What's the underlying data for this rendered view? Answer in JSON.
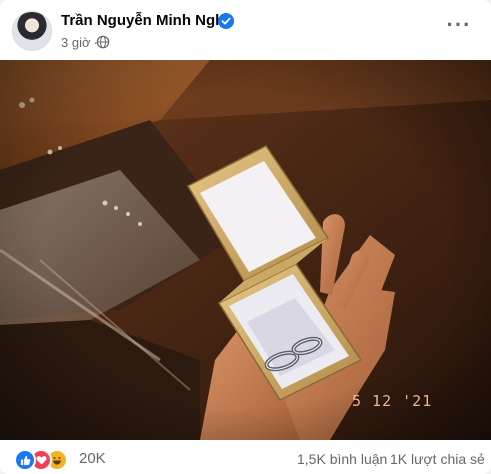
{
  "post": {
    "author": "Trần Nguyễn Minh Nghi",
    "time": "3 giờ",
    "separator": "·",
    "privacy_icon": "globe-icon",
    "verified_icon": "verified-badge-icon",
    "more_icon": "more-options-icon",
    "more_label": "···"
  },
  "photo": {
    "date_stamp": "5 12 '21"
  },
  "engagement": {
    "reaction_icons": [
      "like-icon",
      "love-icon",
      "haha-icon"
    ],
    "reaction_count": "20K",
    "comments": "1,5K bình luận",
    "shares": "1K lượt chia sẻ"
  },
  "colors": {
    "facebook_blue": "#1877f2",
    "love_red": "#f33e58",
    "haha_yellow": "#f7b125",
    "muted_text": "#65676b"
  }
}
